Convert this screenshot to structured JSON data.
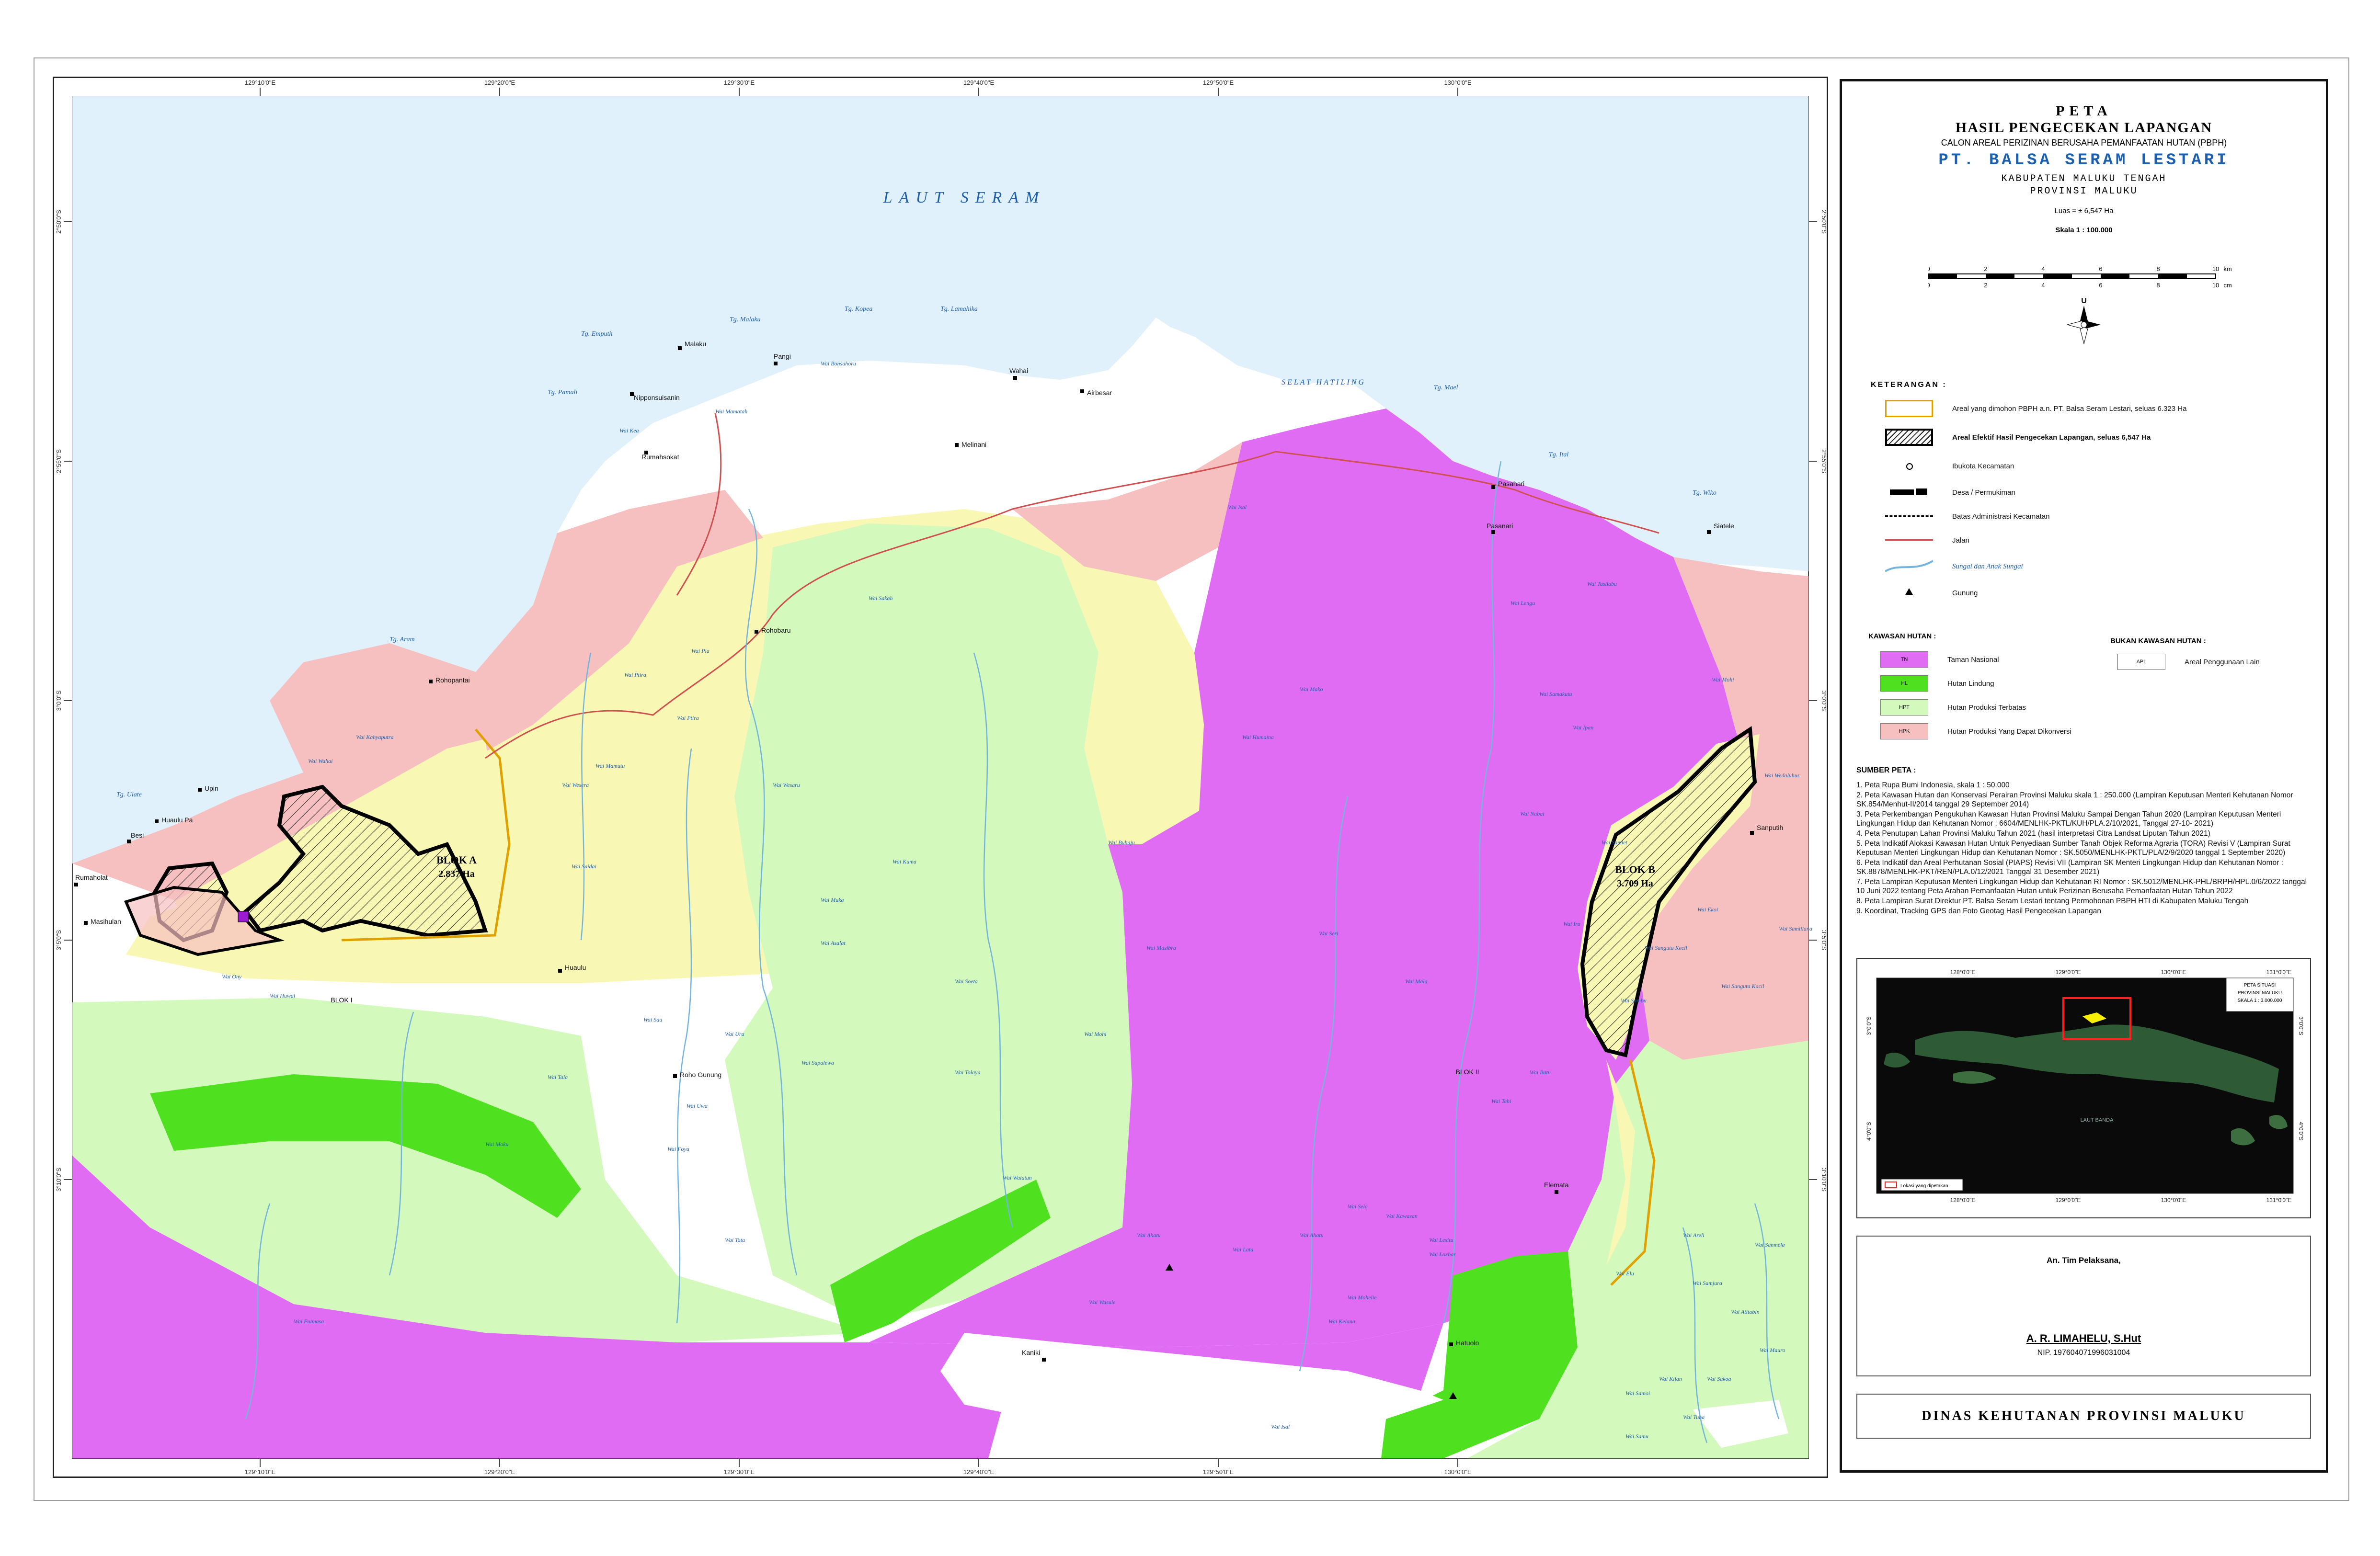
{
  "colors": {
    "sea": "#e1f1fb",
    "tn": "#e06cf4",
    "hl": "#4fe01f",
    "hpt": "#d4f9bc",
    "hp": "#f8f8b4",
    "hpk": "#f6c0c0",
    "apl": "#ffffff",
    "block_line": "#000000",
    "pbph_line": "#e0a000",
    "road": "#d05050",
    "river": "#74b5dd",
    "title_blue": "#1b5fae"
  },
  "map": {
    "sea_label": "LAUT SERAM",
    "strait_label": "SELAT HATILING",
    "lon_ticks": [
      "129°10'0\"E",
      "129°20'0\"E",
      "129°30'0\"E",
      "129°40'0\"E",
      "129°50'0\"E",
      "130°0'0\"E"
    ],
    "lat_ticks": [
      "2°50'0\"S",
      "2°55'0\"S",
      "3°0'0\"S",
      "3°5'0\"S",
      "3°10'0\"S"
    ],
    "block_a_name": "BLOK A",
    "block_a_area": "2.837 Ha",
    "block_b_name": "BLOK B",
    "block_b_area": "3.709 Ha",
    "blok_i": "BLOK I",
    "blok_ii": "BLOK II",
    "villages": [
      "Upin",
      "Huaulu Pa",
      "Besi",
      "Rumaholat",
      "Masihulan",
      "Rumahsokat",
      "Nipponsuisanin",
      "Malaku",
      "Pangi",
      "Wahai",
      "Airbesar",
      "Melinani",
      "Rohobaru",
      "Rohopantai",
      "Huaulu",
      "Roho Gunung",
      "Pasahari",
      "Pasanari",
      "Siatele",
      "Sanputih",
      "Elemata",
      "Hatuolo",
      "Kaniki"
    ],
    "capes": [
      "Tg. Emputh",
      "Tg. Malaku",
      "Tg. Kopea",
      "Tg. Lamahika",
      "Tg. Pamali",
      "Tg. Aram",
      "Tg. Ulate",
      "Tg. Mael",
      "Tg. Ital",
      "Tg. Wiko"
    ],
    "rivers": [
      "Wai Bonsahoru",
      "Wai Kea",
      "Wai Mamatah",
      "Wai Sakah",
      "Wai Kahyaputra",
      "Wai Wesera",
      "Wai Wahai",
      "Wai Mamutu",
      "Wai Isal",
      "Wai Mako",
      "Wai Pia",
      "Wai Ptira",
      "Wai Muka",
      "Wai Soeta",
      "Wai Wesaru",
      "Wai Saidai",
      "Wai Asalat",
      "Wai Lengu",
      "Wai Tasilabu",
      "Wai Humaina",
      "Wai Seri",
      "Wai Buhaju",
      "Wai Ptira",
      "Wai Kuma",
      "Wai Sapalewa",
      "Wai Tolaya",
      "Wai Ony",
      "Wai Huwal",
      "Wai Mala",
      "Wai Tala",
      "Wai Ura",
      "Wai Sau",
      "Wai Uwa",
      "Wai Fuimasa",
      "Wai Foya",
      "Wai Tata",
      "Wai Walatun",
      "Wai Wasule",
      "Wai Ahatu",
      "Wai Lata",
      "Wai Moku",
      "Wai Lesitu",
      "Wai Sela",
      "Wai Tehi",
      "Wai Masibra",
      "Wai Mohi",
      "Wai Kelana",
      "Wai Ahatu",
      "Wai Mohelie",
      "Wai Kawasan",
      "Wai Loxbar",
      "Wai Areli",
      "Wai Batu",
      "Wai Samakutu",
      "Wai Sanguta Kecil",
      "Wai Sanguta Kacil",
      "Wai Ekoi",
      "Wai Samlilana",
      "Wai Wedaluhus",
      "Wai Sambu",
      "Wai Ipan",
      "Wai Mohi",
      "Wai Samlet",
      "Wai Ira",
      "Wai Nabat",
      "Wai Sanmela",
      "Wai Elu",
      "Wai Kilan",
      "Wai Samjura",
      "Wai Samoi",
      "Wai Samu",
      "Wai Sakoa",
      "Wai Atitabin",
      "Wai Mauro",
      "Wai Tuna",
      "Wai Isal"
    ]
  },
  "panel": {
    "title1": "PETA",
    "title2": "HASIL PENGECEKAN LAPANGAN",
    "title3": "CALON AREAL PERIZINAN BERUSAHA PEMANFAATAN HUTAN (PBPH)",
    "company": "PT. BALSA SERAM LESTARI",
    "regency": "KABUPATEN MALUKU TENGAH",
    "province": "PROVINSI MALUKU",
    "area": "Luas = ± 6,547 Ha",
    "scale": "Skala 1 : 100.000",
    "scale_km": [
      "0",
      "2",
      "4",
      "6",
      "8",
      "10",
      "km"
    ],
    "scale_cm": [
      "0",
      "2",
      "4",
      "6",
      "8",
      "10",
      "cm"
    ],
    "north": "U",
    "legend_title": "KETERANGAN :",
    "legend": [
      "Areal yang dimohon PBPH a.n. PT. Balsa Seram Lestari, seluas 6.323 Ha",
      "Areal Efektif Hasil Pengecekan Lapangan, seluas 6,547 Ha",
      "Ibukota Kecamatan",
      "Desa / Permukiman",
      "Batas Administrasi Kecamatan",
      "Jalan",
      "Sungai dan Anak Sungai",
      "Gunung"
    ],
    "forest_title": "KAWASAN HUTAN :",
    "nonforest_title": "BUKAN KAWASAN HUTAN :",
    "forest": [
      {
        "code": "TN",
        "label": "Taman Nasional"
      },
      {
        "code": "HL",
        "label": "Hutan Lindung"
      },
      {
        "code": "HPT",
        "label": "Hutan Produksi Terbatas"
      },
      {
        "code": "HPK",
        "label": "Hutan Produksi Yang Dapat Dikonversi"
      }
    ],
    "apl_code": "APL",
    "apl_label": "Areal Penggunaan Lain",
    "sources_title": "SUMBER PETA :",
    "sources": [
      "1. Peta Rupa Bumi Indonesia, skala 1 : 50.000",
      "2. Peta Kawasan Hutan dan Konservasi Perairan Provinsi Maluku skala 1 : 250.000 (Lampiran Keputusan Menteri Kehutanan Nomor SK.854/Menhut-II/2014 tanggal 29 September 2014)",
      "3. Peta Perkembangan Pengukuhan Kawasan Hutan Provinsi Maluku Sampai Dengan Tahun 2020 (Lampiran Keputusan Menteri Lingkungan Hidup dan Kehutanan Nomor : 6604/MENLHK-PKTL/KUH/PLA.2/10/2021, Tanggal 27-10- 2021)",
      "4. Peta Penutupan Lahan Provinsi Maluku Tahun 2021 (hasil interpretasi Citra Landsat Liputan Tahun 2021)",
      "5. Peta Indikatif Alokasi Kawasan Hutan Untuk Penyediaan Sumber Tanah Objek Reforma Agraria (TORA) Revisi V (Lampiran Surat Keputusan Menteri Lingkungan Hidup dan Kehutanan Nomor : SK.5050/MENLHK-PKTL/PLA/2/9/2020 tanggal 1 September 2020)",
      "6. Peta Indikatif dan Areal Perhutanan Sosial (PIAPS) Revisi VII (Lampiran SK Menteri Lingkungan Hidup dan Kehutanan Nomor : SK.8878/MENLHK-PKT/REN/PLA.0/12/2021 Tanggal 31 Desember 2021)",
      "7. Peta Lampiran Keputusan Menteri Lingkungan Hidup dan Kehutanan RI Nomor : SK.5012/MENLHK-PHL/BRPH/HPL.0/6/2022 tanggal 10 Juni 2022 tentang Peta Arahan Pemanfaatan Hutan untuk Perizinan Berusaha Pemanfaatan Hutan Tahun 2022",
      "8. Peta Lampiran Surat Direktur PT. Balsa Seram Lestari tentang Permohonan PBPH HTI di Kabupaten Maluku Tengah",
      "9. Koordinat, Tracking GPS dan Foto Geotag Hasil Pengecekan Lapangan"
    ],
    "inset_title1": "PETA SITUASI",
    "inset_title2": "PROVINSI MALUKU",
    "inset_title3": "SKALA 1 : 3.000.000",
    "inset_lon": [
      "128°0'0\"E",
      "129°0'0\"E",
      "130°0'0\"E",
      "131°0'0\"E"
    ],
    "inset_lat": [
      "3°0'0\"S",
      "4°0'0\"S"
    ],
    "inset_sea": "LAUT BANDA",
    "inset_legend": "Lokasi yang dipetakan",
    "signer_role": "An. Tim Pelaksana,",
    "signer_name": "A. R. LIMAHELU, S.Hut",
    "signer_nip": "NIP. 197604071996031004",
    "agency": "DINAS KEHUTANAN PROVINSI MALUKU"
  }
}
